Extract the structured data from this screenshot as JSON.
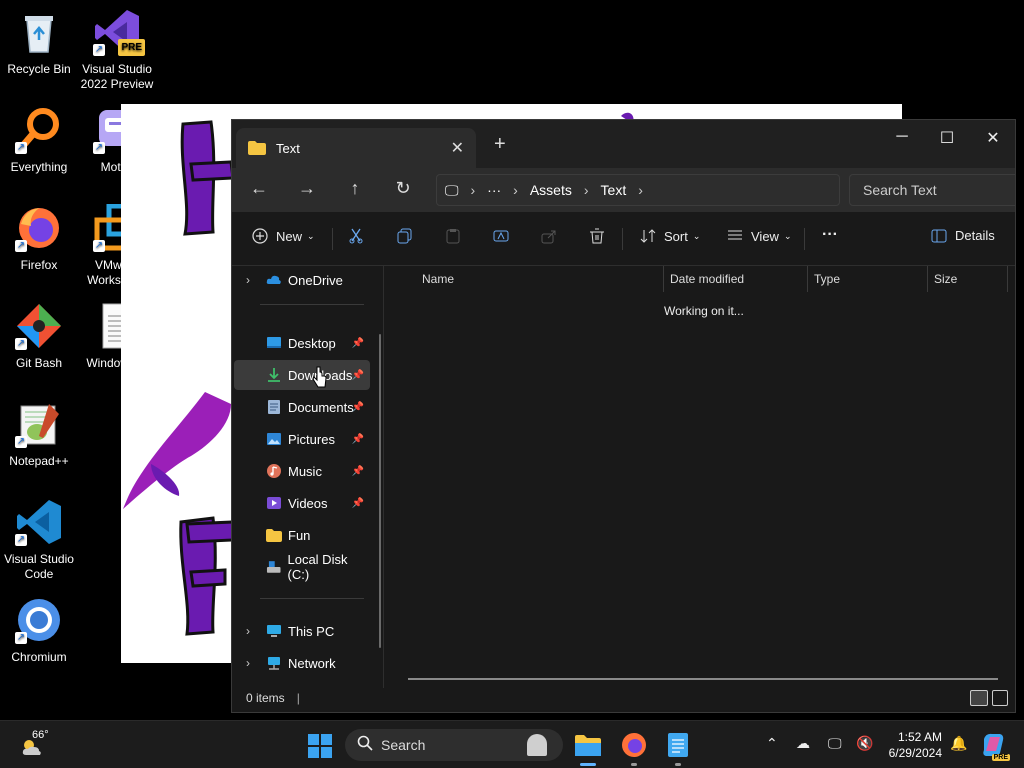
{
  "desktop": {
    "icons": [
      {
        "label": "Recycle Bin"
      },
      {
        "label": "Visual Studio 2022 Preview"
      },
      {
        "label": "Everything"
      },
      {
        "label": "Motrix"
      },
      {
        "label": "Firefox"
      },
      {
        "label": "VMware Workstati..."
      },
      {
        "label": "Git Bash"
      },
      {
        "label": "Windowsl..."
      },
      {
        "label": "Notepad++"
      },
      {
        "label": "Visual Studio Code"
      },
      {
        "label": "Chromium"
      }
    ],
    "vs_badge": "PRE"
  },
  "explorer": {
    "tab_title": "Text",
    "address": {
      "more": "···",
      "crumbs": [
        "Assets",
        "Text"
      ]
    },
    "search_placeholder": "Search Text",
    "commands": {
      "new": "New",
      "sort": "Sort",
      "view": "View",
      "more": "···",
      "details": "Details"
    },
    "nav": {
      "onedrive": "OneDrive",
      "desktop": "Desktop",
      "downloads": "Downloads",
      "documents": "Documents",
      "pictures": "Pictures",
      "music": "Music",
      "videos": "Videos",
      "fun": "Fun",
      "localdisk": "Local Disk (C:)",
      "thispc": "This PC",
      "network": "Network"
    },
    "columns": {
      "name": "Name",
      "date": "Date modified",
      "type": "Type",
      "size": "Size"
    },
    "status_message": "Working on it...",
    "item_count": "0 items"
  },
  "taskbar": {
    "weather_temp": "66°",
    "search_label": "Search",
    "time": "1:52 AM",
    "date": "6/29/2024",
    "copilot_badge": "PRE"
  },
  "colors": {
    "accent_blue": "#0078d4",
    "folder_yellow": "#f5c542",
    "purple": "#6a1bb0"
  }
}
